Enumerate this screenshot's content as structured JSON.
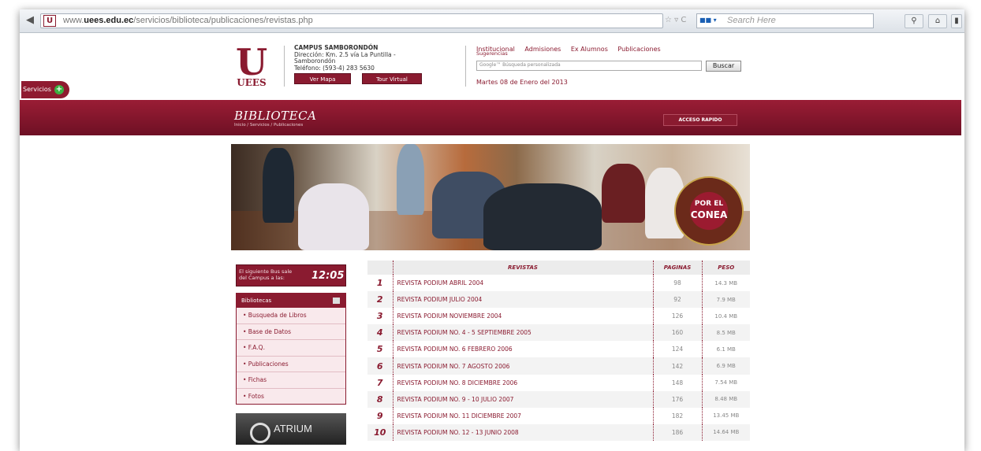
{
  "browser": {
    "url_prefix": "www.",
    "url_domain": "uees.edu.ec",
    "url_path": "/servicios/biblioteca/publicaciones/revistas.php",
    "search_placeholder": "Search Here"
  },
  "servicios_label": "Servicios",
  "logo_text": "UEES",
  "campus": {
    "title": "CAMPUS SAMBORONDÓN",
    "line1": "Dirección: Km. 2.5 vía La Puntilla -",
    "line2": "Samborondón",
    "line3": "Teléfono: (593-4) 283 5630",
    "mapa": "Ver Mapa",
    "tour": "Tour Virtual"
  },
  "topnav": {
    "items": [
      "Institucional",
      "Admisiones",
      "Ex Alumnos",
      "Publicaciones"
    ],
    "sugerencias": "Sugerencias",
    "search_placeholder": "Google™ Búsqueda personalizada",
    "buscar": "Buscar",
    "fecha": "Martes 08 de Enero del 2013"
  },
  "banner": {
    "title": "BIBLIOTECA",
    "breadcrumb": "Inicio / Servicios / Publicaciones",
    "acceso": "ACCESO RAPIDO"
  },
  "seal": {
    "line1": "POR EL",
    "line2": "CONEA"
  },
  "bus": {
    "label": "El siguiente Bus sale del Campus a las:",
    "time": "12:05"
  },
  "bibliotecas": {
    "header": "Bibliotecas",
    "items": [
      "• Busqueda de Libros",
      "• Base de Datos",
      "• F.A.Q.",
      "• Publicaciones",
      "• Fichas",
      "• Fotos"
    ]
  },
  "atrium_label": "ATRIUM",
  "table": {
    "headers": {
      "revistas": "REVISTAS",
      "paginas": "PAGINAS",
      "peso": "PESO"
    },
    "rows": [
      {
        "num": "1",
        "name": "REVISTA PODIUM ABRIL 2004",
        "pag": "98",
        "peso": "14.3 MB"
      },
      {
        "num": "2",
        "name": "REVISTA PODIUM JULIO 2004",
        "pag": "92",
        "peso": "7.9 MB"
      },
      {
        "num": "3",
        "name": "REVISTA PODIUM NOVIEMBRE 2004",
        "pag": "126",
        "peso": "10.4 MB"
      },
      {
        "num": "4",
        "name": "REVISTA PODIUM NO. 4 - 5 SEPTIEMBRE 2005",
        "pag": "160",
        "peso": "8.5 MB"
      },
      {
        "num": "5",
        "name": "REVISTA PODIUM NO. 6 FEBRERO 2006",
        "pag": "124",
        "peso": "6.1 MB"
      },
      {
        "num": "6",
        "name": "REVISTA PODIUM NO. 7 AGOSTO 2006",
        "pag": "142",
        "peso": "6.9 MB"
      },
      {
        "num": "7",
        "name": "REVISTA PODIUM NO. 8 DICIEMBRE 2006",
        "pag": "148",
        "peso": "7.54 MB"
      },
      {
        "num": "8",
        "name": "REVISTA PODIUM NO. 9 - 10 JULIO 2007",
        "pag": "176",
        "peso": "8.48 MB"
      },
      {
        "num": "9",
        "name": "REVISTA PODIUM NO. 11 DICIEMBRE 2007",
        "pag": "182",
        "peso": "13.45 MB"
      },
      {
        "num": "10",
        "name": "REVISTA PODIUM NO. 12 - 13 JUNIO 2008",
        "pag": "186",
        "peso": "14.64 MB"
      }
    ]
  },
  "colors": {
    "brand": "#8a1b30",
    "servicios_plus": "#3cb043"
  }
}
